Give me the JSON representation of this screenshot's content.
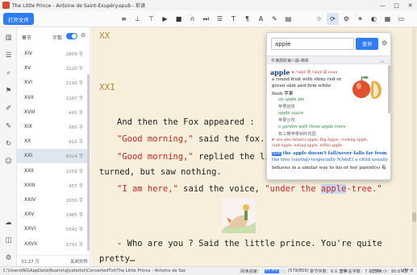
{
  "window": {
    "title": "The Little Prince - Antoine de Saint-Exupéry.epub - 彩读",
    "controls": [
      "—",
      "□",
      "✕"
    ]
  },
  "toolbar": {
    "open_label": "打开文件"
  },
  "toc": {
    "title": "章节",
    "word_count_label": "字数",
    "word_count_enabled": true,
    "items": [
      {
        "name": "XIV",
        "count": "2809 字"
      },
      {
        "name": "XV",
        "count": "3120 字"
      },
      {
        "name": "XVI",
        "count": "1199 字"
      },
      {
        "name": "XVII",
        "count": "2187 字"
      },
      {
        "name": "XVIII",
        "count": "443 字"
      },
      {
        "name": "XIX",
        "count": "660 字"
      },
      {
        "name": "XX",
        "count": "910 字"
      },
      {
        "name": "XXI",
        "count": "6024 字"
      },
      {
        "name": "XXII",
        "count": "1059 字"
      },
      {
        "name": "XXIII",
        "count": "457 字"
      },
      {
        "name": "XXIV",
        "count": "2630 字"
      },
      {
        "name": "XXV",
        "count": "2985 字"
      },
      {
        "name": "XXVI",
        "count": "5541 字"
      },
      {
        "name": "XXVII",
        "count": "1742 字"
      }
    ],
    "selected_index": 7,
    "total": "31.27 万",
    "close_label": "关闭文件"
  },
  "reader": {
    "prev_chapter": "XX",
    "chapter": "XXI",
    "l1": "And then the Fox appeared :",
    "l2_q": "\"Good morning,\"",
    "l2_t": " said the fox.",
    "l3_q": "\"Good morning,\"",
    "l3_t": " replied the li",
    "l4": "turned, but saw nothing.",
    "l5_q1": "\"I am here,\"",
    "l5_t": " said the voice, ",
    "l5_q2a": "\"under the ",
    "l5_hl": "apple",
    "l5_q2b": "-tree.\"",
    "l6": "- Who are you ? Said the little prince. You're quite",
    "l7": "pretty…"
  },
  "dictionary": {
    "query": "apple",
    "search_label": "查询",
    "dict_name": "牛津高阶第八版-简体",
    "headword": "apple",
    "pron": "★ /ˈæpl/ 英 /ˈæpl/ 美 noun",
    "def_en": [
      "a round fruit with shiny red or",
      "green skin and firm white",
      "flesh 苹果"
    ],
    "examples": [
      {
        "en": "an apple pie",
        "zh": "苹果馅饼"
      },
      {
        "en": "apple sauce",
        "zh": "苹果沙司"
      },
      {
        "en": "a garden with three apple trees",
        "zh": "有三棵苹果树的花园"
      }
    ],
    "see_also": "☛ see also Adam's apple, Big Apple, cooking apple,",
    "see_also2": "crab apple, eating apple, toffee apple",
    "idiom_badge": "IDM",
    "idiom": "the apple doesn't fall/never falls far from",
    "idiom2": "the tree (saying) (especially NAmE) a child usually",
    "idiom3": "behaves in a similar way to his or her parent(s) 有"
  },
  "status": {
    "path": "C:\\Users\\NG\\AppData\\Roaming\\colortxt\\ConvertedTxt\\The Little Prince - Antoine de Saint-Exupéry.epub…",
    "progress_label": "阅读进度：",
    "progress_percent": 67.9,
    "progress_text": "67.9%",
    "position": "(579/859)",
    "chapter_words": "章节字数：6.0 万字",
    "file_words": "文件总字数：7.9 万字",
    "file_size": "文件大小：80.6 KB",
    "encoding": "UTF-8"
  }
}
